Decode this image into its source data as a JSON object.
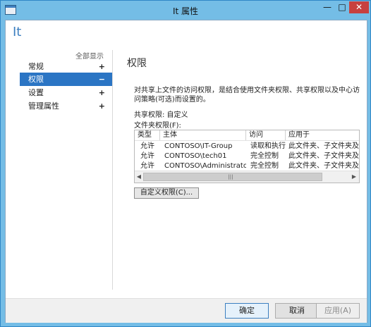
{
  "window": {
    "title": "It 属性",
    "controls": {
      "minimize": "—",
      "maximize": "□",
      "close": "✕"
    }
  },
  "header": {
    "title": "It"
  },
  "nav": {
    "show_all": "全部显示",
    "items": [
      {
        "label": "常规",
        "sign": "+"
      },
      {
        "label": "权限",
        "sign": "−",
        "selected": true
      },
      {
        "label": "设置",
        "sign": "+"
      },
      {
        "label": "管理属性",
        "sign": "+"
      }
    ]
  },
  "main": {
    "section_title": "权限",
    "description": "对共享上文件的访问权限，是结合使用文件夹权限、共享权限以及中心访问策略(可选)而设置的。",
    "share_permission": "共享权限: 自定义",
    "folder_permission_label": "文件夹权限(F):",
    "table": {
      "columns": [
        "类型",
        "主体",
        "访问",
        "应用于"
      ],
      "rows": [
        [
          "允许",
          "CONTOSO\\IT-Group",
          "读取和执行",
          "此文件夹、子文件夹及"
        ],
        [
          "允许",
          "CONTOSO\\tech01",
          "完全控制",
          "此文件夹、子文件夹及"
        ],
        [
          "允许",
          "CONTOSO\\Administrator",
          "完全控制",
          "此文件夹、子文件夹及"
        ]
      ]
    },
    "scroll": {
      "left": "◀",
      "right": "▶",
      "grip": "|||"
    },
    "custom_button": "自定义权限(C)..."
  },
  "footer": {
    "ok": "确定",
    "cancel": "取消",
    "apply": "应用(A)"
  },
  "colors": {
    "accent": "#2b75c4",
    "title_blue": "#3c7fc0",
    "close_red": "#c7413f",
    "frame": "#74bde6"
  }
}
